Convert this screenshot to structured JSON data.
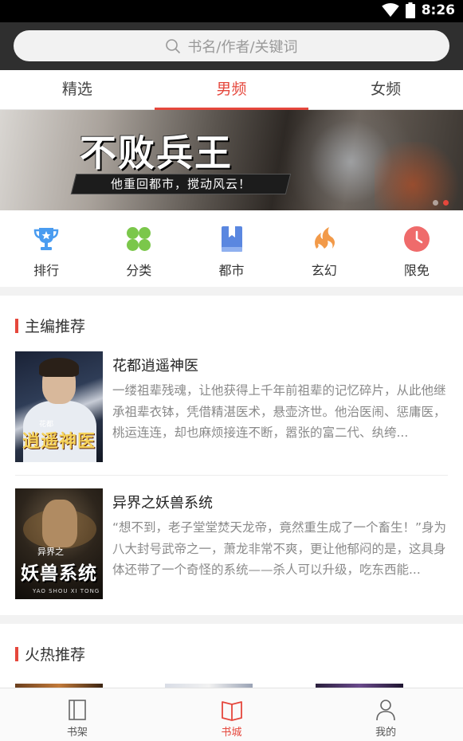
{
  "status_bar": {
    "time": "8:26"
  },
  "search": {
    "placeholder": "书名/作者/关键词"
  },
  "tabs": [
    {
      "label": "精选",
      "active": false
    },
    {
      "label": "男频",
      "active": true
    },
    {
      "label": "女频",
      "active": false
    }
  ],
  "banner": {
    "title": "不败兵王",
    "slogan": "他重回都市，搅动风云！",
    "page_count": 2,
    "active_page": 1
  },
  "quick_nav": [
    {
      "label": "排行",
      "icon": "trophy-icon",
      "color": "#4a9cf0"
    },
    {
      "label": "分类",
      "icon": "clover-icon",
      "color": "#7bc74b"
    },
    {
      "label": "都市",
      "icon": "book-icon",
      "color": "#5a87e0"
    },
    {
      "label": "玄幻",
      "icon": "flame-icon",
      "color": "#f29a49"
    },
    {
      "label": "限免",
      "icon": "clock-icon",
      "color": "#ef6b6b"
    }
  ],
  "editor_picks": {
    "title": "主编推荐",
    "books": [
      {
        "title": "花都逍遥神医",
        "description": "一缕祖辈残魂，让他获得上千年前祖辈的记忆碎片，从此他继承祖辈衣钵，凭借精湛医术，悬壶济世。他治医闹、惩庸医，桃运连连，却也麻烦接连不断，嚣张的富二代、纨绔...",
        "cover_text": "逍遥神医",
        "cover_subtext": "花都"
      },
      {
        "title": "异界之妖兽系统",
        "description": "“想不到，老子堂堂焚天龙帝，竟然重生成了一个畜生！”身为八大封号武帝之一，萧龙非常不爽，更让他郁闷的是，这具身体还带了一个奇怪的系统——杀人可以升级，吃东西能...",
        "cover_text": "妖兽系统",
        "cover_subtext": "异界之",
        "cover_pinyin": "YAO SHOU XI TONG"
      }
    ]
  },
  "hot_picks": {
    "title": "火热推荐"
  },
  "bottom_nav": [
    {
      "label": "书架",
      "icon": "bookshelf-icon",
      "active": false
    },
    {
      "label": "书城",
      "icon": "bookstore-icon",
      "active": true
    },
    {
      "label": "我的",
      "icon": "profile-icon",
      "active": false
    }
  ],
  "colors": {
    "accent": "#e5473c",
    "header_bg": "#2f2f2f",
    "text_muted": "#8a8a8a"
  }
}
